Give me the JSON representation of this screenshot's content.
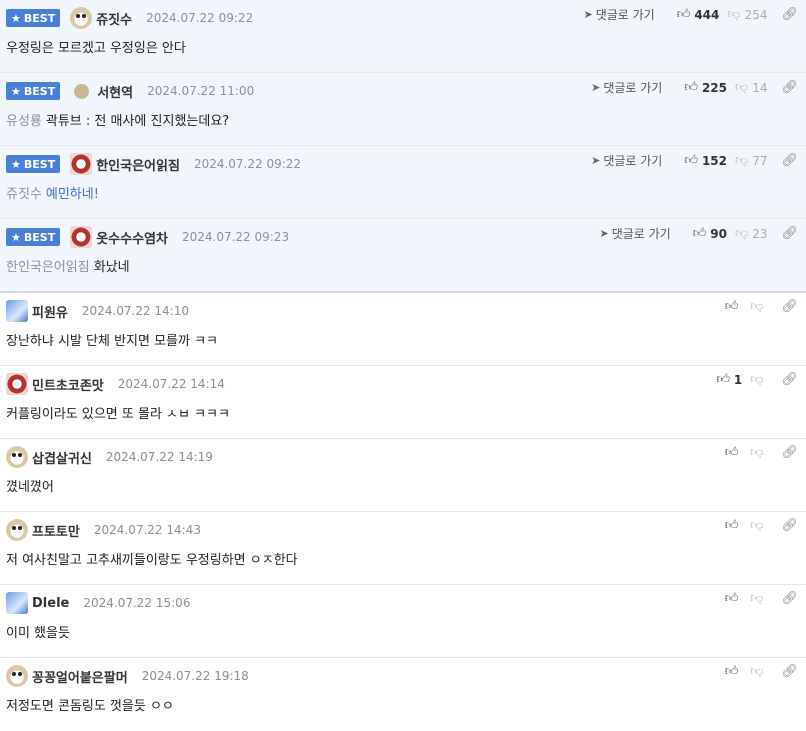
{
  "best_label": "BEST",
  "go_label": "댓글로 가기",
  "best": [
    {
      "nick": "쥬짓수",
      "date": "2024.07.22 09:22",
      "reply_to": "",
      "text": "우정링은 모르겠고 우정잉은 안다",
      "up": "444",
      "down": "254",
      "avatar": "dog"
    },
    {
      "nick": "서현역",
      "date": "2024.07.22 11:00",
      "reply_to": "유성룡",
      "text": "곽튜브 : 전 매사에 진지했는데요?",
      "up": "225",
      "down": "14",
      "avatar": "circle"
    },
    {
      "nick": "한인국은어읽짐",
      "date": "2024.07.22 09:22",
      "reply_to": "쥬짓수",
      "text": "예민하네!",
      "up": "152",
      "down": "77",
      "avatar": "pink"
    },
    {
      "nick": "옷수수수염차",
      "date": "2024.07.22 09:23",
      "reply_to": "한인국은어읽짐",
      "text": "화났네",
      "up": "90",
      "down": "23",
      "avatar": "pink"
    }
  ],
  "comments": [
    {
      "nick": "피원유",
      "date": "2024.07.22 14:10",
      "text": "장난하냐 시발 단체 반지면 모를까 ㅋㅋ",
      "up": "",
      "avatar": "blue"
    },
    {
      "nick": "민트초코존맛",
      "date": "2024.07.22 14:14",
      "text": "커플링이라도 있으면 또 몰라 ㅅㅂ ㅋㅋㅋ",
      "up": "1",
      "avatar": "pink"
    },
    {
      "nick": "삽겹살귀신",
      "date": "2024.07.22 14:19",
      "text": "꼈네꼈어",
      "up": "",
      "avatar": "dog"
    },
    {
      "nick": "프토토만",
      "date": "2024.07.22 14:43",
      "text": "저 여사친말고 고추새끼들이랑도 우정링하면 ㅇㅈ한다",
      "up": "",
      "avatar": "dog"
    },
    {
      "nick": "Dlele",
      "date": "2024.07.22 15:06",
      "text": "이미 했을듯",
      "up": "",
      "avatar": "blue"
    },
    {
      "nick": "꽁꽁얼어붙은팔머",
      "date": "2024.07.22 19:18",
      "text": "저정도면 콘돔링도 껏을듯 ㅇㅇ",
      "up": "",
      "avatar": "dog"
    }
  ]
}
